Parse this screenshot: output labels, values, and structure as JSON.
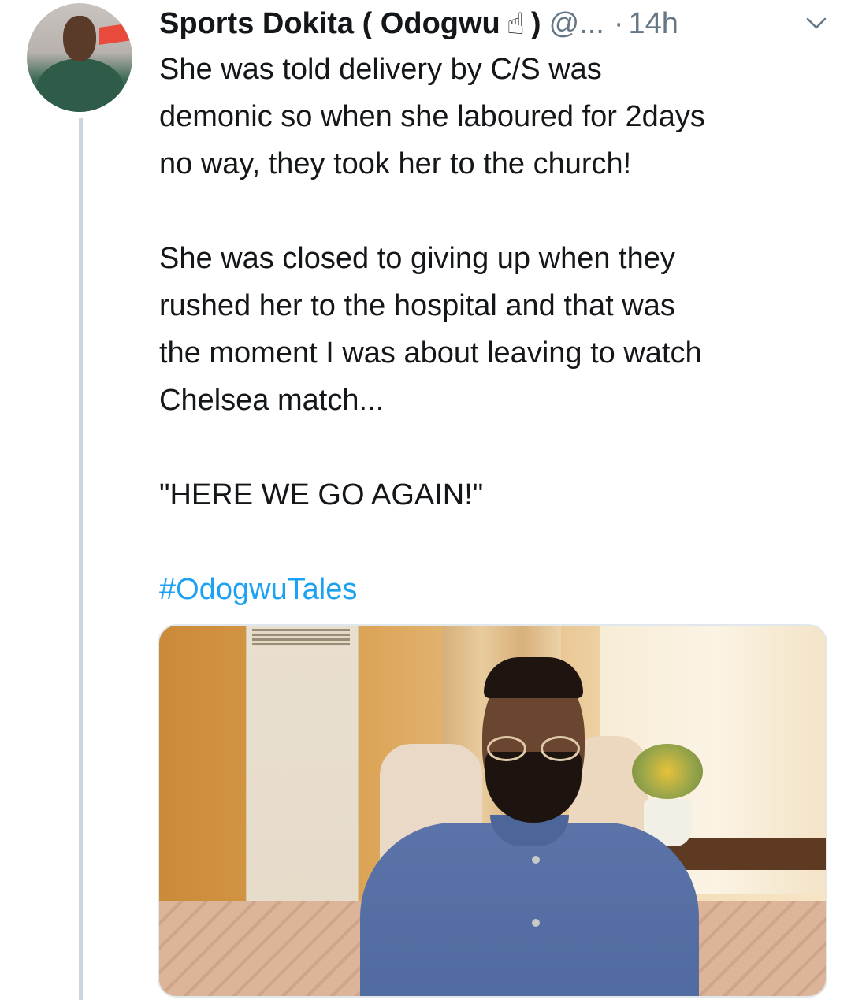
{
  "tweet": {
    "author_name": "Sports Dokita ( Odogwu",
    "author_emoji": "☝",
    "author_name_close": ")",
    "handle": "@...",
    "separator": "·",
    "time": "14h",
    "text": "She was told delivery by C/S was\ndemonic so when she laboured for 2days\nno way, they took her to the church!\n\nShe was closed to giving up when they\nrushed her to the hospital and that was\nthe moment I was about leaving to watch\nChelsea match...\n\n\"HERE WE GO AGAIN!\"",
    "hashtag": "#OdogwuTales"
  },
  "icons": {
    "caret": "chevron-down-icon"
  },
  "colors": {
    "text": "#14171a",
    "secondary": "#657786",
    "link": "#1da1f2",
    "thread_line": "#ccd6dd"
  }
}
